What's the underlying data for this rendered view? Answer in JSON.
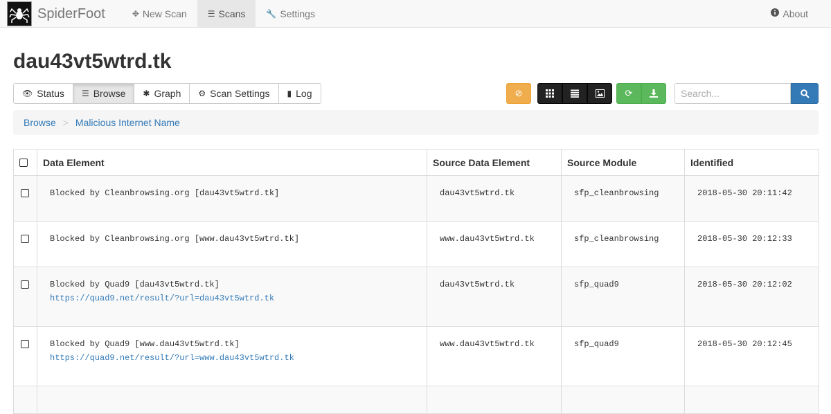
{
  "nav": {
    "brand": "SpiderFoot",
    "new_scan": "New Scan",
    "scans": "Scans",
    "settings": "Settings",
    "about": "About"
  },
  "page_title": "dau43vt5wtrd.tk",
  "tabs": [
    "Status",
    "Browse",
    "Graph",
    "Scan Settings",
    "Log"
  ],
  "search": {
    "placeholder": "Search..."
  },
  "breadcrumb": {
    "root": "Browse",
    "current": "Malicious Internet Name"
  },
  "table": {
    "headers": [
      "Data Element",
      "Source Data Element",
      "Source Module",
      "Identified"
    ],
    "rows": [
      {
        "element": "Blocked by Cleanbrowsing.org [dau43vt5wtrd.tk]",
        "link": "",
        "source": "dau43vt5wtrd.tk",
        "module": "sfp_cleanbrowsing",
        "identified": "2018-05-30 20:11:42"
      },
      {
        "element": "Blocked by Cleanbrowsing.org [www.dau43vt5wtrd.tk]",
        "link": "",
        "source": "www.dau43vt5wtrd.tk",
        "module": "sfp_cleanbrowsing",
        "identified": "2018-05-30 20:12:33"
      },
      {
        "element": "Blocked by Quad9 [dau43vt5wtrd.tk]",
        "link": "https://quad9.net/result/?url=dau43vt5wtrd.tk",
        "source": "dau43vt5wtrd.tk",
        "module": "sfp_quad9",
        "identified": "2018-05-30 20:12:02"
      },
      {
        "element": "Blocked by Quad9 [www.dau43vt5wtrd.tk]",
        "link": "https://quad9.net/result/?url=www.dau43vt5wtrd.tk",
        "source": "www.dau43vt5wtrd.tk",
        "module": "sfp_quad9",
        "identified": "2018-05-30 20:12:45"
      }
    ]
  },
  "colors": {
    "warning": "#f0ad4e",
    "dark": "#222222",
    "success": "#5cb85c",
    "primary": "#337ab7"
  },
  "icons": {
    "stop": "ban-icon",
    "view_table": "grid-icon",
    "view_list": "list-icon",
    "view_image": "image-icon",
    "refresh": "refresh-icon",
    "export": "download-icon",
    "search": "search-icon"
  }
}
